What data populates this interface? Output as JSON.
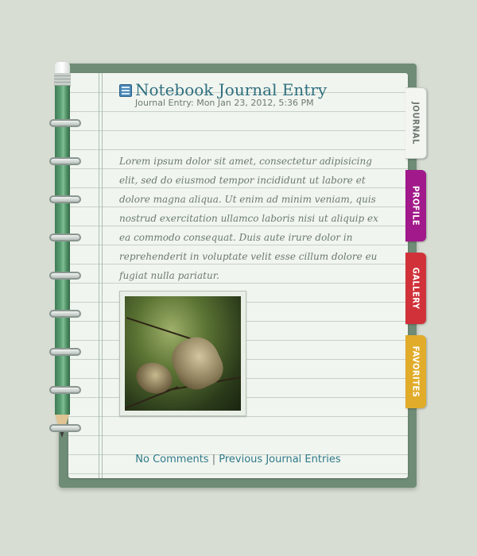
{
  "entry": {
    "title": "Notebook Journal Entry",
    "date": "Journal Entry: Mon Jan 23, 2012, 5:36 PM",
    "body": "Lorem ipsum dolor sit amet, consectetur adipisicing elit, sed do eiusmod tempor incididunt ut labore et dolore magna aliqua. Ut enim ad minim veniam, quis nostrud exercitation ullamco laboris nisi ut aliquip ex ea commodo consequat. Duis aute irure dolor in reprehenderit in voluptate velit esse cillum dolore eu fugiat nulla pariatur."
  },
  "footer": {
    "comments": "No Comments",
    "separator": "|",
    "previous": "Previous Journal Entries"
  },
  "tabs": [
    {
      "label": "JOURNAL",
      "color": "#f3f5f1"
    },
    {
      "label": "PROFILE",
      "color": "#a1198a"
    },
    {
      "label": "GALLERY",
      "color": "#d1323a"
    },
    {
      "label": "FAVORITES",
      "color": "#e1ac2a"
    }
  ],
  "icons": {
    "entry_icon": "notebook-icon",
    "binder": "spiral-ring-icon",
    "pencil": "pencil-icon"
  }
}
